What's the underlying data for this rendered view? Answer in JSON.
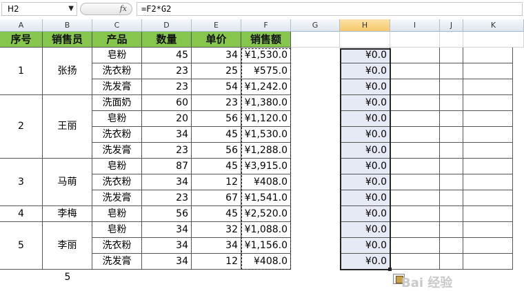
{
  "formula_bar": {
    "name_box": "H2",
    "fx_label": "fx",
    "formula": "=F2*G2"
  },
  "columns": [
    "A",
    "B",
    "C",
    "D",
    "E",
    "F",
    "G",
    "H",
    "I",
    "J",
    "K"
  ],
  "header_row": [
    "序号",
    "销售员",
    "产品",
    "数量",
    "单价",
    "销售额"
  ],
  "groups": [
    {
      "seq": "1",
      "seller": "张扬"
    },
    {
      "seq": "2",
      "seller": "王丽"
    },
    {
      "seq": "3",
      "seller": "马萌"
    },
    {
      "seq": "4",
      "seller": "李梅"
    },
    {
      "seq": "5",
      "seller": "李丽"
    }
  ],
  "rows": [
    {
      "product": "皂粉",
      "qty": "45",
      "price": "34",
      "amount": "¥1,530.0",
      "h": "¥0.0"
    },
    {
      "product": "洗衣粉",
      "qty": "23",
      "price": "25",
      "amount": "¥575.0",
      "h": "¥0.0"
    },
    {
      "product": "洗发膏",
      "qty": "23",
      "price": "54",
      "amount": "¥1,242.0",
      "h": "¥0.0"
    },
    {
      "product": "洗面奶",
      "qty": "60",
      "price": "23",
      "amount": "¥1,380.0",
      "h": "¥0.0"
    },
    {
      "product": "皂粉",
      "qty": "20",
      "price": "56",
      "amount": "¥1,120.0",
      "h": "¥0.0"
    },
    {
      "product": "洗衣粉",
      "qty": "34",
      "price": "45",
      "amount": "¥1,530.0",
      "h": "¥0.0"
    },
    {
      "product": "洗发膏",
      "qty": "23",
      "price": "56",
      "amount": "¥1,288.0",
      "h": "¥0.0"
    },
    {
      "product": "皂粉",
      "qty": "87",
      "price": "45",
      "amount": "¥3,915.0",
      "h": "¥0.0"
    },
    {
      "product": "洗衣粉",
      "qty": "34",
      "price": "12",
      "amount": "¥408.0",
      "h": "¥0.0"
    },
    {
      "product": "洗发膏",
      "qty": "23",
      "price": "67",
      "amount": "¥1,541.0",
      "h": "¥0.0"
    },
    {
      "product": "皂粉",
      "qty": "56",
      "price": "45",
      "amount": "¥2,520.0",
      "h": "¥0.0"
    },
    {
      "product": "皂粉",
      "qty": "34",
      "price": "32",
      "amount": "¥1,088.0",
      "h": "¥0.0"
    },
    {
      "product": "洗衣粉",
      "qty": "34",
      "price": "34",
      "amount": "¥1,156.0",
      "h": "¥0.0"
    },
    {
      "product": "洗发膏",
      "qty": "34",
      "price": "12",
      "amount": "¥408.0",
      "h": "¥0.0"
    }
  ],
  "footer_value": "5",
  "watermark": "Bai 经验",
  "colors": {
    "header_green": "#86c64d",
    "selection_tint": "#e6eaf5"
  }
}
